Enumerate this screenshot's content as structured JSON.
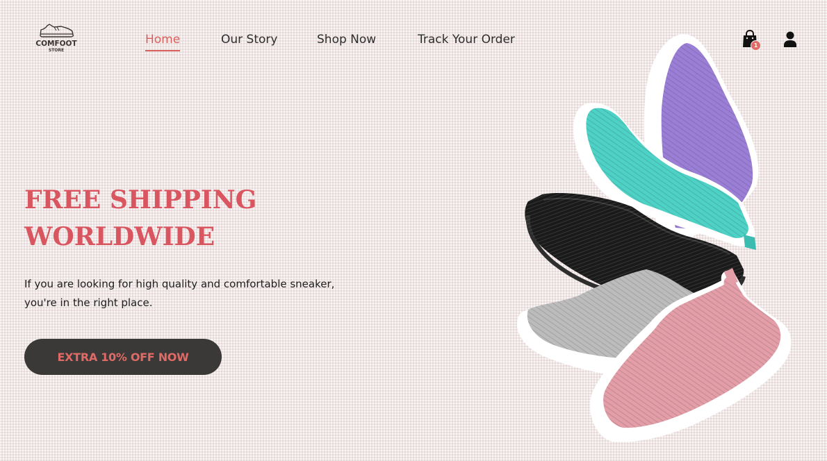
{
  "logo": {
    "name": "COMFOOT",
    "sub": "STORE",
    "icon": "sneaker-outline-icon"
  },
  "nav": {
    "items": [
      {
        "label": "Home",
        "active": true
      },
      {
        "label": "Our Story",
        "active": false
      },
      {
        "label": "Shop Now",
        "active": false
      },
      {
        "label": "Track Your Order",
        "active": false
      }
    ]
  },
  "header_actions": {
    "cart_icon": "shopping-bag-icon",
    "cart_count": "1",
    "account_icon": "user-icon"
  },
  "hero": {
    "title_line1": "FREE SHIPPING",
    "title_line2": "WORLDWIDE",
    "description_line1": "If you are looking for high quality and comfortable sneaker,",
    "description_line2": "you're in the right place.",
    "cta_label": "EXTRA 10% OFF NOW",
    "image_subject": "stacked knit slip-on sneakers (purple, teal, black, grey, pink)"
  },
  "colors": {
    "accent": "#d9615d",
    "title": "#d9555f",
    "button_bg": "#3b3838",
    "button_text": "#e06a65",
    "background": "#f0e6e6",
    "text_dark": "#2d2d2d"
  }
}
